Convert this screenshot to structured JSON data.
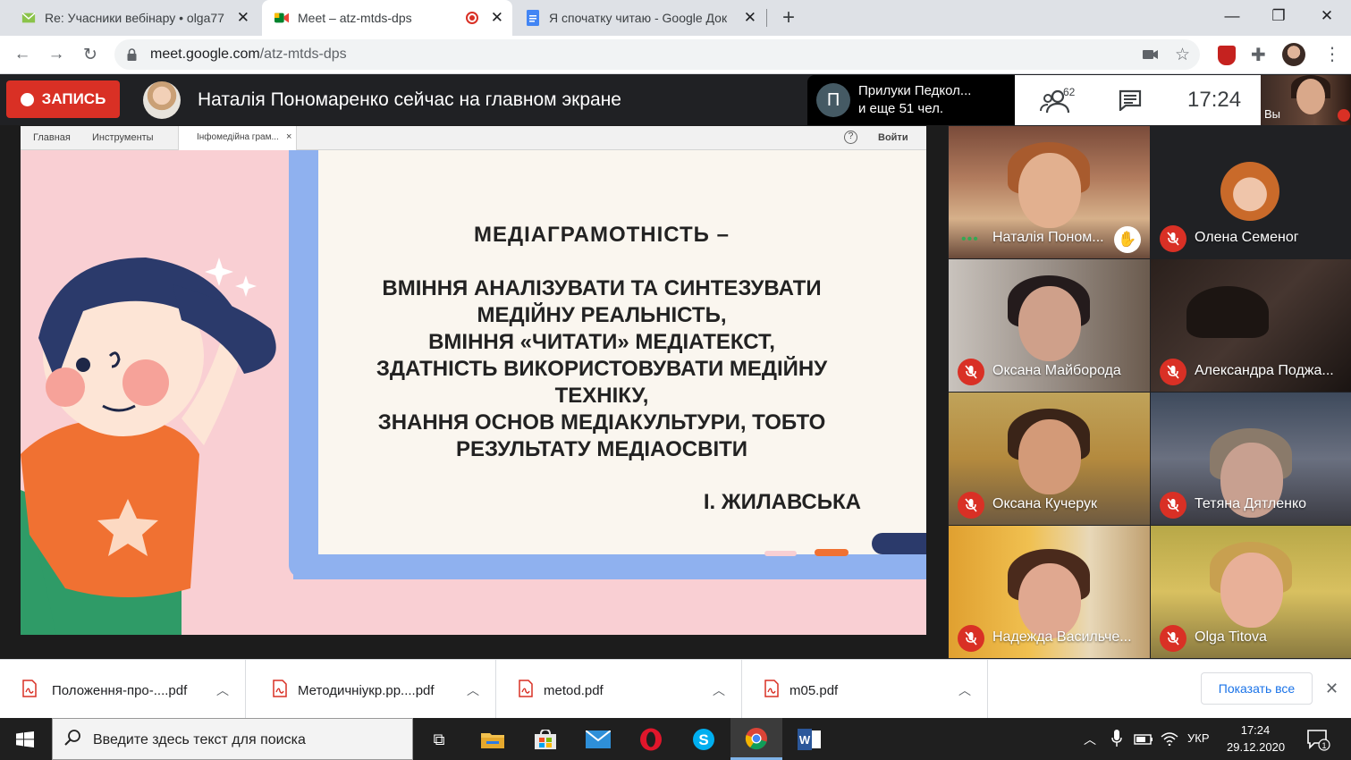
{
  "browser": {
    "tabs": [
      {
        "title": "Re: Учасники вебінару • olga77"
      },
      {
        "title": "Meet – atz-mtds-dps"
      },
      {
        "title": "Я спочатку читаю - Google Док"
      }
    ],
    "new_tab": "+",
    "address": {
      "domain": "meet.google.com",
      "path": "/atz-mtds-dps"
    }
  },
  "meet": {
    "record_label": "ЗАПИСЬ",
    "presenting_text": "Наталія Пономаренко сейчас на главном экране",
    "caption": {
      "initial": "П",
      "line1": "Прилуки Педкол...",
      "line2": "и еще 51 чел."
    },
    "people_count": "62",
    "clock": "17:24",
    "self_label": "Вы",
    "doc_toolbar": {
      "home": "Главная",
      "tools": "Инструменты",
      "tab": "Інфомедійна грам...",
      "tab_close": "×",
      "help": "?",
      "login": "Войти"
    },
    "slide": {
      "title": "МЕДІАГРАМОТНІСТЬ  –",
      "body": "ВМІННЯ АНАЛІЗУВАТИ ТА СИНТЕЗУВАТИ\nМЕДІЙНУ РЕАЛЬНІСТЬ,\nВМІННЯ «ЧИТАТИ» МЕДІАТЕКСТ,\nЗДАТНІСТЬ ВИКОРИСТОВУВАТИ МЕДІЙНУ\nТЕХНІКУ,\nЗНАННЯ ОСНОВ МЕДІАКУЛЬТУРИ, ТОБТО\nРЕЗУЛЬТАТУ МЕДІАОСВІТИ",
      "author": "І. ЖИЛАВСЬКА"
    },
    "participants": [
      {
        "name": "Наталія Поном...",
        "muted": false
      },
      {
        "name": "Олена Семеног",
        "muted": true
      },
      {
        "name": "Оксана Майборода",
        "muted": true
      },
      {
        "name": "Александра Поджа...",
        "muted": true
      },
      {
        "name": "Оксана Кучерук",
        "muted": true
      },
      {
        "name": "Тетяна Дятленко",
        "muted": true
      },
      {
        "name": "Надежда Васильче...",
        "muted": true
      },
      {
        "name": "Olga Titova",
        "muted": true
      }
    ]
  },
  "downloads": {
    "files": [
      "Положення-про-....pdf",
      "Методичнiукр.pp....pdf",
      "metod.pdf",
      "m05.pdf"
    ],
    "show_all": "Показать все"
  },
  "taskbar": {
    "search_placeholder": "Введите здесь текст для поиска",
    "lang": "УКР",
    "time": "17:24",
    "date": "29.12.2020"
  },
  "colors": {
    "record": "#d93025",
    "meet_bg": "#202124",
    "link": "#1a73e8"
  }
}
